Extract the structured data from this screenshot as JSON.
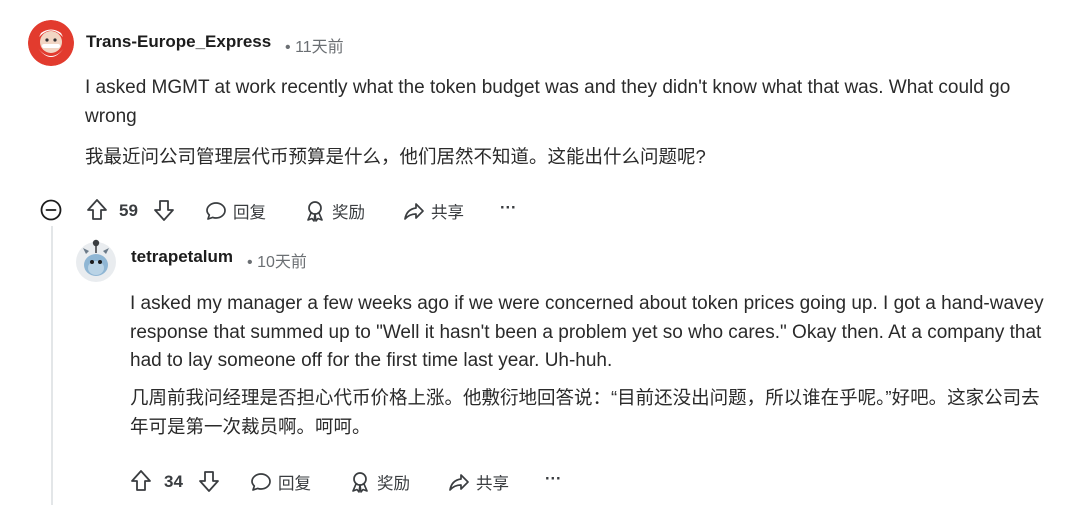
{
  "comment1": {
    "username": "Trans-Europe_Express",
    "time": "11天前",
    "text_en": "I asked MGMT at work recently what the token budget was and they didn't know what that was. What could go wrong",
    "text_cn": "我最近问公司管理层代币预算是什么，他们居然不知道。这能出什么问题呢?",
    "score": "59",
    "reply_label": "回复",
    "award_label": "奖励",
    "share_label": "共享",
    "more_label": "···"
  },
  "comment2": {
    "username": "tetrapetalum",
    "time": "10天前",
    "text_en": "I asked my manager a few weeks ago if we were concerned about token prices going up. I got a hand-wavey response that summed up to \"Well it hasn't been a problem yet so who cares.\" Okay then. At a company that had to lay someone off for the first time last year. Uh-huh.",
    "text_cn": "几周前我问经理是否担心代币价格上涨。他敷衍地回答说：“目前还没出问题，所以谁在乎呢。”好吧。这家公司去年可是第一次裁员啊。呵呵。",
    "score": "34",
    "reply_label": "回复",
    "award_label": "奖励",
    "share_label": "共享",
    "more_label": "···"
  },
  "separator": "•",
  "icons": [
    "avatar",
    "upvote-icon",
    "downvote-icon",
    "reply-icon",
    "award-icon",
    "share-icon",
    "more-icon",
    "collapse-icon"
  ]
}
